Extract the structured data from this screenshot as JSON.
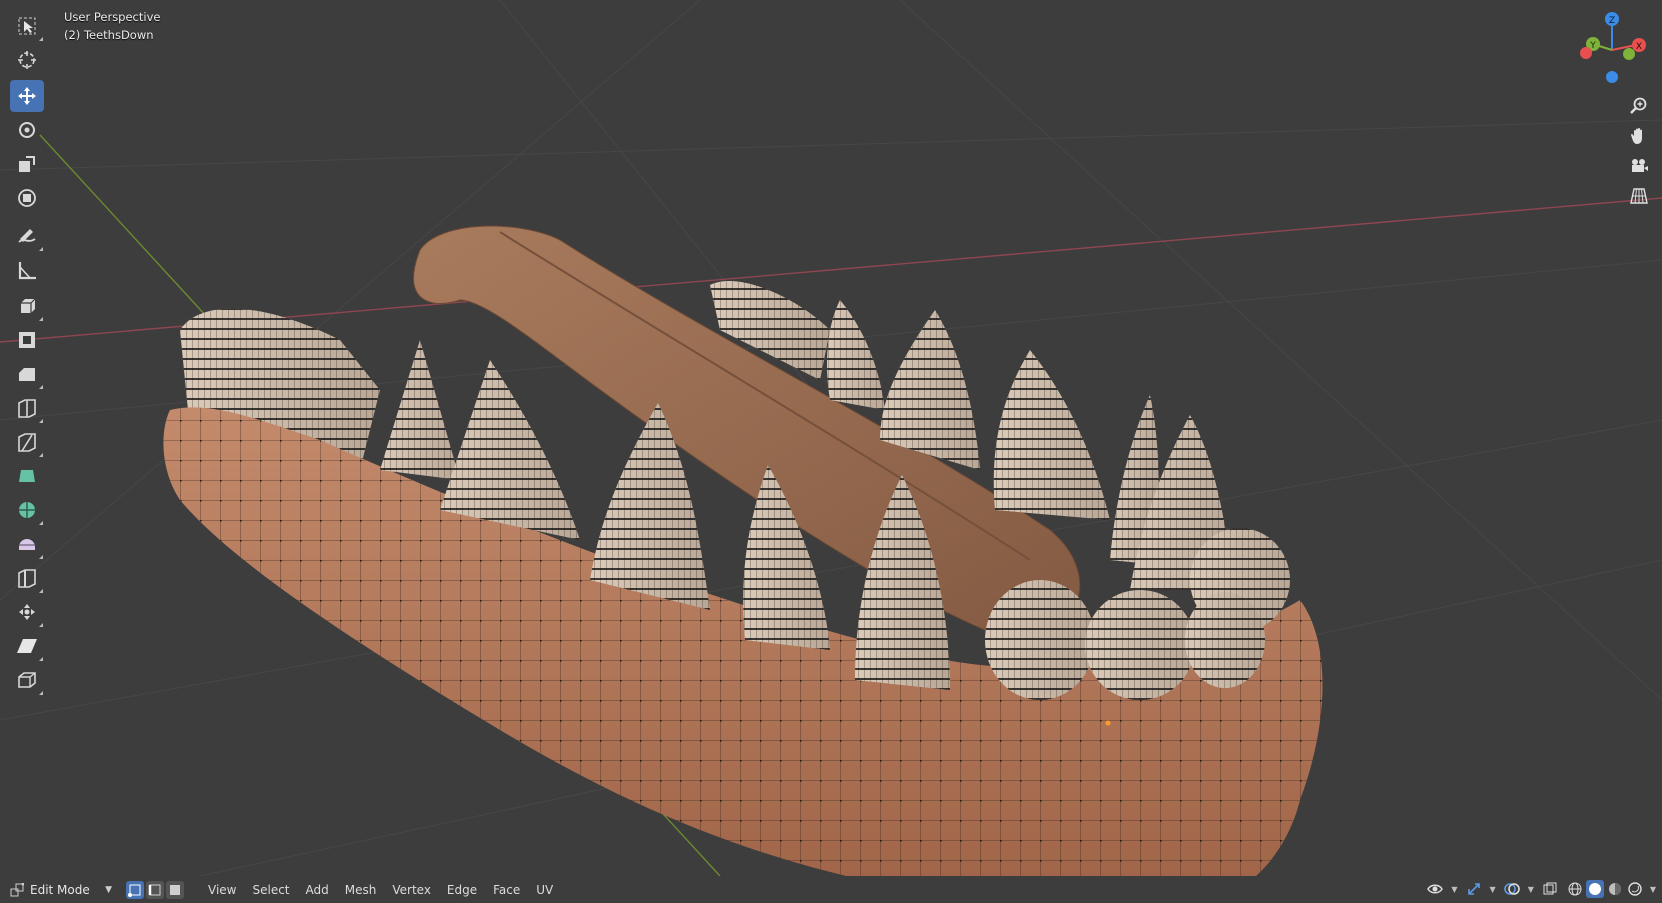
{
  "viewport": {
    "perspective_label": "User Perspective",
    "object_label": "(2) TeethsDown"
  },
  "toolbar": {
    "tools": [
      {
        "name": "select-box",
        "icon": "select-box-icon",
        "active": false
      },
      {
        "name": "cursor",
        "icon": "cursor-icon",
        "active": false
      },
      {
        "name": "move",
        "icon": "move-icon",
        "active": true
      },
      {
        "name": "rotate",
        "icon": "rotate-icon",
        "active": false
      },
      {
        "name": "scale",
        "icon": "scale-icon",
        "active": false
      },
      {
        "name": "transform",
        "icon": "transform-icon",
        "active": false
      },
      {
        "name": "annotate",
        "icon": "annotate-icon",
        "active": false
      },
      {
        "name": "measure",
        "icon": "measure-icon",
        "active": false
      },
      {
        "name": "extrude",
        "icon": "extrude-icon",
        "active": false
      },
      {
        "name": "inset",
        "icon": "inset-icon",
        "active": false
      },
      {
        "name": "bevel",
        "icon": "bevel-icon",
        "active": false
      },
      {
        "name": "loop-cut",
        "icon": "loop-cut-icon",
        "active": false
      },
      {
        "name": "knife",
        "icon": "knife-icon",
        "active": false
      },
      {
        "name": "poly-build",
        "icon": "poly-build-icon",
        "active": false
      },
      {
        "name": "spin",
        "icon": "spin-icon",
        "active": false
      },
      {
        "name": "smooth",
        "icon": "smooth-icon",
        "active": false
      },
      {
        "name": "edge-slide",
        "icon": "edge-slide-icon",
        "active": false
      },
      {
        "name": "shrink-fatten",
        "icon": "shrink-fatten-icon",
        "active": false
      },
      {
        "name": "shear",
        "icon": "shear-icon",
        "active": false
      },
      {
        "name": "rip-region",
        "icon": "rip-region-icon",
        "active": false
      }
    ]
  },
  "gizmo": {
    "axes": {
      "x": "X",
      "y": "Y",
      "z": "Z"
    },
    "colors": {
      "x": "#e8504f",
      "y": "#7fb239",
      "z": "#3b8ce6"
    }
  },
  "nav_buttons": [
    "zoom-icon",
    "pan-hand-icon",
    "camera-icon",
    "ortho-grid-icon"
  ],
  "header": {
    "mode": "Edit Mode",
    "menus": [
      "View",
      "Select",
      "Add",
      "Mesh",
      "Vertex",
      "Edge",
      "Face",
      "UV"
    ],
    "select_modes": [
      "vertex-select-icon",
      "edge-select-icon",
      "face-select-icon"
    ],
    "active_select_mode": "vertex"
  },
  "colors": {
    "viewport_bg": "#3d3d3d",
    "grid": "#4a4a4a",
    "active_blue": "#4772b3",
    "gum": "#b5785a",
    "tongue": "#9a6e52",
    "teeth": "#cdbcaa"
  }
}
